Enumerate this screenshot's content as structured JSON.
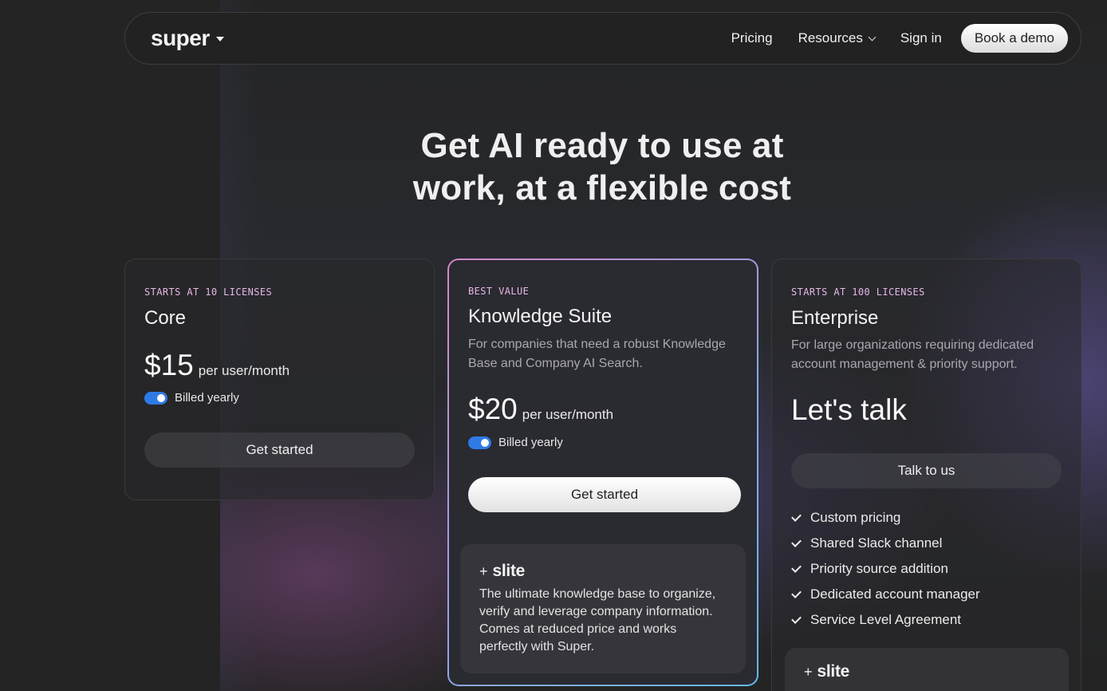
{
  "nav": {
    "logo": "super",
    "links": [
      "Pricing",
      "Resources",
      "Sign in"
    ],
    "cta": "Book a demo"
  },
  "hero": {
    "line1": "Get AI ready to use at",
    "line2": "work, at a flexible cost"
  },
  "plans": {
    "core": {
      "eyebrow": "STARTS AT 10 LICENSES",
      "title": "Core",
      "price": "$15",
      "per": "per user/month",
      "billing": "Billed yearly",
      "cta": "Get started"
    },
    "suite": {
      "eyebrow": "BEST VALUE",
      "title": "Knowledge Suite",
      "desc": "For companies that need a robust Knowledge Base and Company AI Search.",
      "price": "$20",
      "per": "per user/month",
      "billing": "Billed yearly",
      "cta": "Get started",
      "addon": {
        "plus": "+",
        "logo": "slite",
        "desc": "The ultimate knowledge base to organize, verify and leverage company information. Comes at reduced price and works perfectly with Super."
      }
    },
    "enterprise": {
      "eyebrow": "STARTS AT 100 LICENSES",
      "title": "Enterprise",
      "desc": "For large organizations requiring dedicated account management & priority support.",
      "price": "Let's talk",
      "cta": "Talk to us",
      "features": [
        "Custom pricing",
        "Shared Slack channel",
        "Priority source addition",
        "Dedicated account manager",
        "Service Level Agreement"
      ],
      "addon": {
        "plus": "+",
        "logo": "slite"
      }
    }
  },
  "colors": {
    "accent_toggle": "#2f7ae5",
    "eyebrow": "#e6b8e6"
  }
}
